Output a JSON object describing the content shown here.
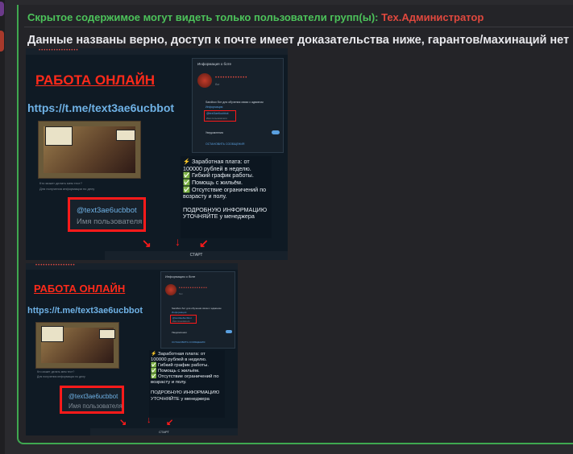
{
  "post": {
    "hidden_notice_prefix": "Скрытое содержимое могут видеть только пользователи групп(ы):",
    "hidden_notice_group": "Тех.Администратор",
    "text": "Данные названы верно, доступ к почте имеет доказательства ниже, гарантов/махинаций нет"
  },
  "screenshot": {
    "header_stars": "••••••••••••••••",
    "title": "РАБОТА ОНЛАЙН",
    "link": "https://t.me/text3ae6ucbbot",
    "meme_caption": "Кто может делать мем тест?",
    "meme_caption2": "Для получения информации по делу",
    "bot_panel": {
      "title": "Информация о боте",
      "name_stars": "•••••••••••••",
      "status": "бот",
      "description": "Sandbox бот для обучения связи с админом",
      "desc_sub": "Информация",
      "username_line": "@text3ae6ucbbot",
      "username_sub": "Имя пользователя",
      "notifications": "Уведомления",
      "stop_link": "ОСТАНОВИТЬ СООБЩЕНИЯ"
    },
    "offer": {
      "line1": "⚡ Заработная плата: от",
      "line2": "100000 рублей в неделю.",
      "line3": "✅ Гибкий график работы.",
      "line4": "✅ Помощь с жильём.",
      "line5": "✅ Отсутствие ограничений по",
      "line6": "возрасту и полу.",
      "line7": "",
      "line8": "ПОДРОБНУЮ ИНФОРМАЦИЮ",
      "line9": "УТОЧНЯЙТЕ у менеджера"
    },
    "handle": "@text3ae6ucbbot",
    "handle_sub": "Имя пользователя",
    "start_button": "СТАРТ",
    "arrow": "↘"
  },
  "colors": {
    "accent_green": "#4cc25a",
    "group_red": "#e0483e",
    "highlight_red": "#ff1a1a"
  }
}
